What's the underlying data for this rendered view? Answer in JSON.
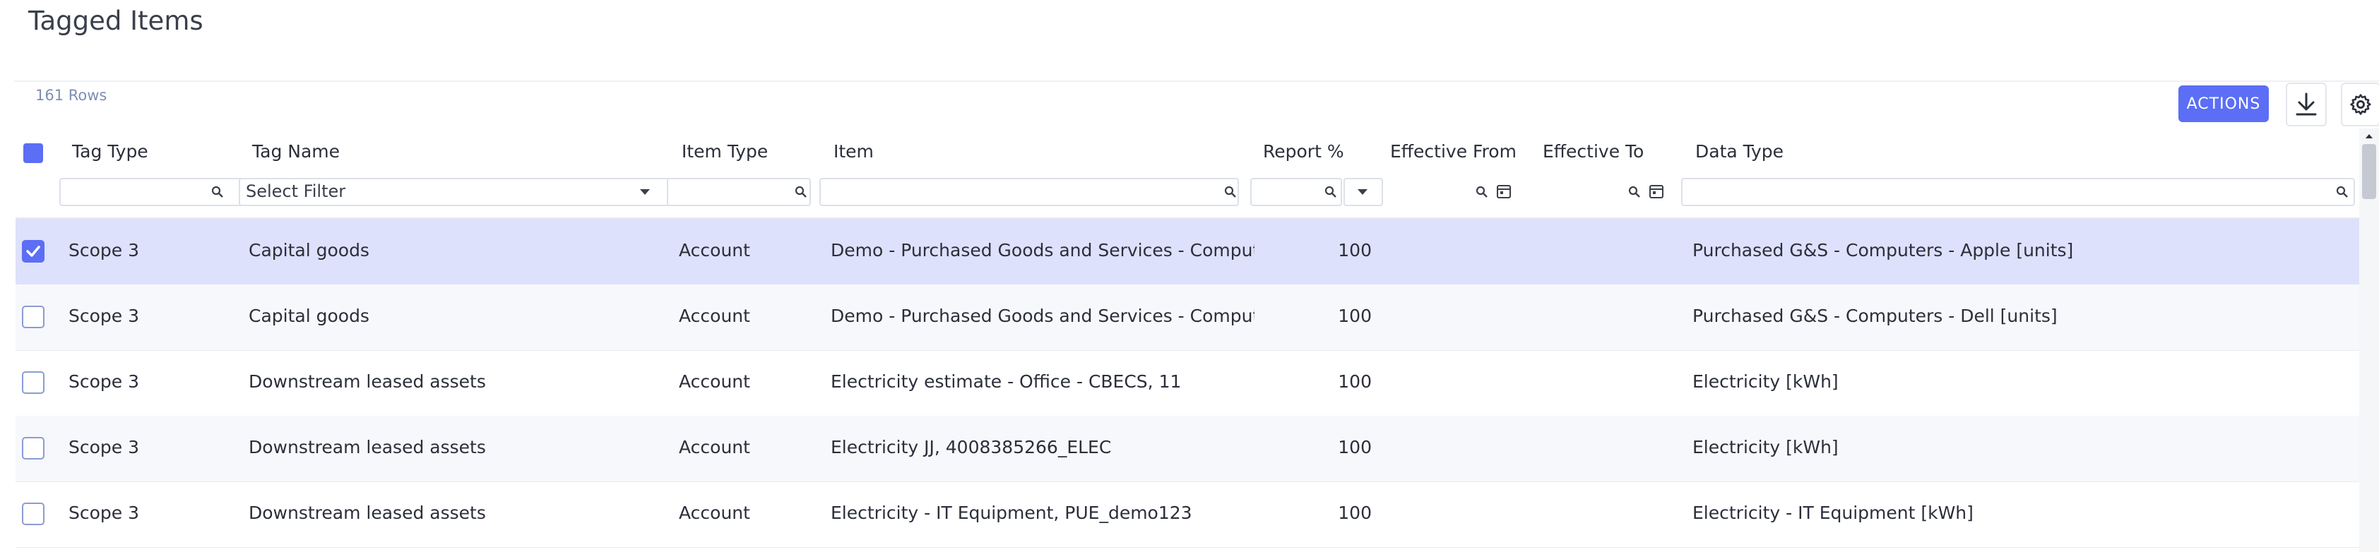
{
  "page": {
    "title": "Tagged Items"
  },
  "toolbar": {
    "row_count": "161 Rows",
    "actions_label": "ACTIONS",
    "download_icon": "download-icon",
    "settings_icon": "gear-icon"
  },
  "table": {
    "columns": [
      "Tag Type",
      "Tag Name",
      "Item Type",
      "Item",
      "Report %",
      "Effective From",
      "Effective To",
      "Data Type"
    ],
    "filters": {
      "tag_name_placeholder": "Select Filter",
      "tag_type": "",
      "item_type": "",
      "item": "",
      "report_pct": "",
      "effective_from": "",
      "effective_to": "",
      "data_type": ""
    },
    "rows": [
      {
        "selected": true,
        "tag_type": "Scope 3",
        "tag_name": "Capital goods",
        "item_type": "Account",
        "item": "Demo - Purchased Goods and Services - Compute…",
        "report_pct": "100",
        "effective_from": "",
        "effective_to": "",
        "data_type": "Purchased G&S - Computers - Apple [units]"
      },
      {
        "selected": false,
        "tag_type": "Scope 3",
        "tag_name": "Capital goods",
        "item_type": "Account",
        "item": "Demo - Purchased Goods and Services - Compute…",
        "report_pct": "100",
        "effective_from": "",
        "effective_to": "",
        "data_type": "Purchased G&S - Computers - Dell [units]"
      },
      {
        "selected": false,
        "tag_type": "Scope 3",
        "tag_name": "Downstream leased assets",
        "item_type": "Account",
        "item": "Electricity estimate - Office - CBECS, 11",
        "report_pct": "100",
        "effective_from": "",
        "effective_to": "",
        "data_type": "Electricity [kWh]"
      },
      {
        "selected": false,
        "tag_type": "Scope 3",
        "tag_name": "Downstream leased assets",
        "item_type": "Account",
        "item": "Electricity JJ, 4008385266_ELEC",
        "report_pct": "100",
        "effective_from": "",
        "effective_to": "",
        "data_type": "Electricity [kWh]"
      },
      {
        "selected": false,
        "tag_type": "Scope 3",
        "tag_name": "Downstream leased assets",
        "item_type": "Account",
        "item": "Electricity - IT Equipment, PUE_demo123",
        "report_pct": "100",
        "effective_from": "",
        "effective_to": "",
        "data_type": "Electricity - IT Equipment [kWh]"
      }
    ]
  },
  "colors": {
    "accent": "#5b6ef5",
    "selected_row": "#dde1fb",
    "muted_text": "#7d8fb3"
  }
}
